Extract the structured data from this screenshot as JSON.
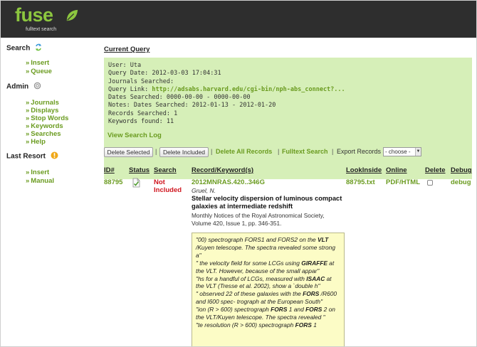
{
  "app": {
    "logo_text": "fuse",
    "logo_subtitle": "fulltext search",
    "brand_green": "#8cc63f",
    "link_green": "#6a9b1f",
    "alert_red": "#d0161f"
  },
  "sidebar": {
    "groups": [
      {
        "title": "Search",
        "icon": "refresh-icon",
        "items": [
          "Insert",
          "Queue"
        ]
      },
      {
        "title": "Admin",
        "icon": "gear-icon",
        "items": [
          "Journals",
          "Displays",
          "Stop Words",
          "Keywords",
          "Searches",
          "Help"
        ]
      },
      {
        "title": "Last Resort",
        "icon": "warning-icon",
        "items": [
          "Insert",
          "Manual"
        ]
      }
    ]
  },
  "query": {
    "section_title": "Current Query",
    "user": "User: Uta",
    "query_date": "Query Date: 2012-03-03 17:04:31",
    "journals_searched": "Journals Searched:",
    "query_link_label": "Query Link: ",
    "query_link": "http://adsabs.harvard.edu/cgi-bin/nph-abs_connect?...",
    "dates_searched": "Dates Searched: 0000-00-00 - 0000-00-00",
    "notes": "Notes: Dates Searched: 2012-01-13 - 2012-01-20",
    "records_searched": "Records Searched: 1",
    "keywords_found": "Keywords found: 11",
    "view_log": "View Search Log"
  },
  "toolbar": {
    "delete_selected": "Delete Selected",
    "delete_included": "Delete Included",
    "delete_all": "Delete All Records",
    "fulltext_search": "Fulltext Search",
    "export_label": "Export Records",
    "export_select": "- choose -",
    "separator": "|"
  },
  "table": {
    "headers": {
      "id": "ID#",
      "status": "Status",
      "search": "Search",
      "record": "Record/Keyword(s)",
      "look_inside": "LookInside",
      "online": "Online",
      "delete": "Delete",
      "debug": "Debug"
    },
    "rows": [
      {
        "id": "88795",
        "status_icon": "document-check-icon",
        "search_line1": "Not",
        "search_line2": "Included",
        "bibcode": "2012MNRAS.420..346G",
        "author": "Gruel, N.",
        "title": "Stellar velocity dispersion of luminous compact galaxies at intermediate redshift",
        "journal": "Monthly Notices of the Royal Astronomical Society, Volume 420, Issue 1, pp. 346-351.",
        "look_inside": "88795.txt",
        "online": "PDF/HTML",
        "delete_checked": false,
        "debug": "debug",
        "snippets": [
          {
            "pre": "\"00) spectrograph FORS1 and FORS2 on the ",
            "kw": "VLT",
            "post": " /Kuyen telescope. The spectra revealed some strong a\""
          },
          {
            "pre": "\" the velocity field for some LCGs using ",
            "kw": "GIRAFFE",
            "post": " at the VLT. However, because of the small appar\""
          },
          {
            "pre": "\"hs for a handful of LCGs, measured with ",
            "kw": "ISAAC",
            "post": " at the VLT (Tresse et al. 2002), show a `double h\""
          },
          {
            "pre": "\" observed 22 of these galaxies with the ",
            "kw": "FORS",
            "post": " /R600 and I600 spec- trograph at the European South\""
          },
          {
            "pre": "\"ion (R > 600) spectrograph ",
            "kw": "FORS",
            "post": " 1 and ",
            "kw2": "FORS",
            "post2": " 2 on the VLT/Kuyen telescope. The spectra revealed \""
          },
          {
            "pre": "\"te resolution (R > 600) spectrograph ",
            "kw": "FORS",
            "post": " 1"
          }
        ]
      }
    ]
  }
}
